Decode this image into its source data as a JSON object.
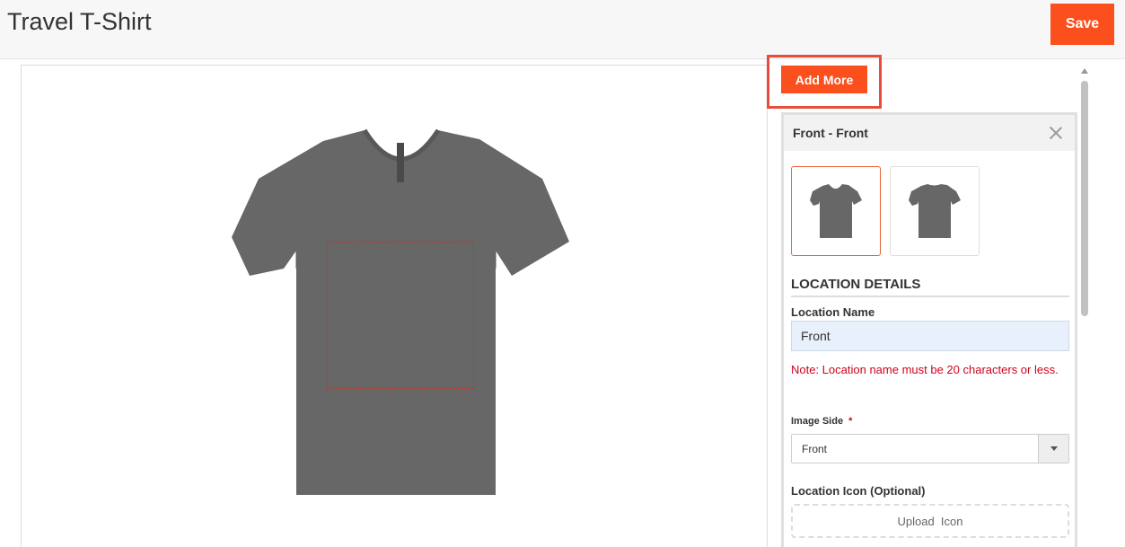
{
  "header": {
    "title": "Travel T-Shirt",
    "save_label": "Save"
  },
  "toolbar": {
    "add_more_label": "Add More"
  },
  "panel": {
    "title": "Front - Front",
    "section_title": "LOCATION DETAILS",
    "location_name_label": "Location Name",
    "location_name_value": "Front",
    "note": "Note: Location name must be 20 characters or less.",
    "image_side_label": "Image Side",
    "required_mark": "*",
    "image_side_value": "Front",
    "location_icon_label": "Location Icon (Optional)",
    "upload_label": "Upload  Icon"
  },
  "colors": {
    "accent": "#fc4f1e",
    "shirt": "#676767",
    "note": "#d0021b",
    "highlight": "#e74c3c"
  }
}
